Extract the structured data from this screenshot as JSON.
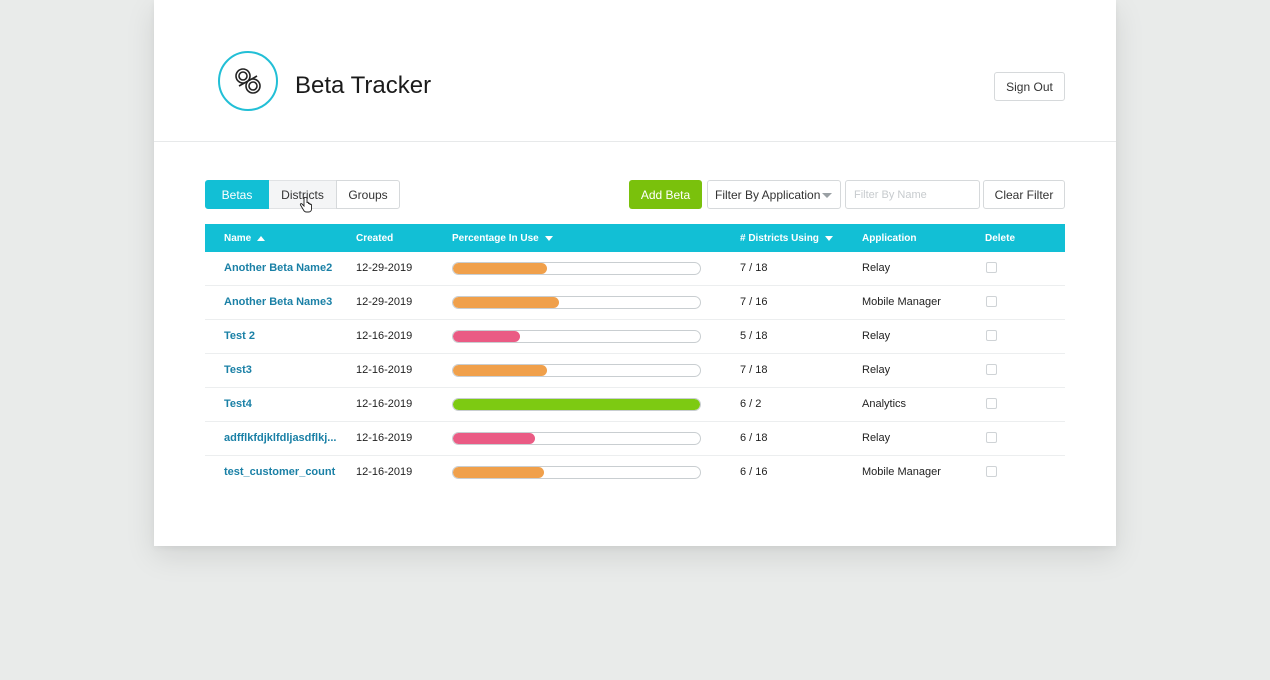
{
  "app": {
    "title": "Beta Tracker",
    "sign_out_label": "Sign Out"
  },
  "tabs": [
    {
      "label": "Betas",
      "active": true
    },
    {
      "label": "Districts",
      "active": false
    },
    {
      "label": "Groups",
      "active": false
    }
  ],
  "toolbar": {
    "add_beta_label": "Add Beta",
    "filter_application_value": "Filter By Application",
    "filter_name_placeholder": "Filter By Name",
    "clear_filter_label": "Clear Filter"
  },
  "table": {
    "columns": [
      "Name",
      "Created",
      "Percentage In Use",
      "# Districts Using",
      "Application",
      "Delete"
    ],
    "sort": {
      "Name": "ascending",
      "Percentage In Use": "descending",
      "# Districts Using": "descending"
    },
    "rows": [
      {
        "name": "Another Beta Name2",
        "created": "12-29-2019",
        "percent_fraction": 0.38,
        "color": "#f0a04b",
        "districts": "7 / 18",
        "application": "Relay"
      },
      {
        "name": "Another Beta Name3",
        "created": "12-29-2019",
        "percent_fraction": 0.43,
        "color": "#f0a04b",
        "districts": "7 / 16",
        "application": "Mobile Manager"
      },
      {
        "name": "Test 2",
        "created": "12-16-2019",
        "percent_fraction": 0.27,
        "color": "#ea5b84",
        "districts": "5 / 18",
        "application": "Relay"
      },
      {
        "name": "Test3",
        "created": "12-16-2019",
        "percent_fraction": 0.38,
        "color": "#f0a04b",
        "districts": "7 / 18",
        "application": "Relay"
      },
      {
        "name": "Test4",
        "created": "12-16-2019",
        "percent_fraction": 1.0,
        "color": "#7dca12",
        "districts": "6 / 2",
        "application": "Analytics"
      },
      {
        "name": "adfflkfdjklfdljasdflkj...",
        "created": "12-16-2019",
        "percent_fraction": 0.33,
        "color": "#ea5b84",
        "districts": "6 / 18",
        "application": "Relay"
      },
      {
        "name": "test_customer_count",
        "created": "12-16-2019",
        "percent_fraction": 0.37,
        "color": "#f0a04b",
        "districts": "6 / 16",
        "application": "Mobile Manager"
      }
    ]
  },
  "colors": {
    "accent": "#12bfd5",
    "add_button": "#7ac10c",
    "link": "#1a80a6"
  },
  "icons": {
    "logo": "infinity-loop-logo",
    "cursor": "hand-pointer-icon"
  }
}
